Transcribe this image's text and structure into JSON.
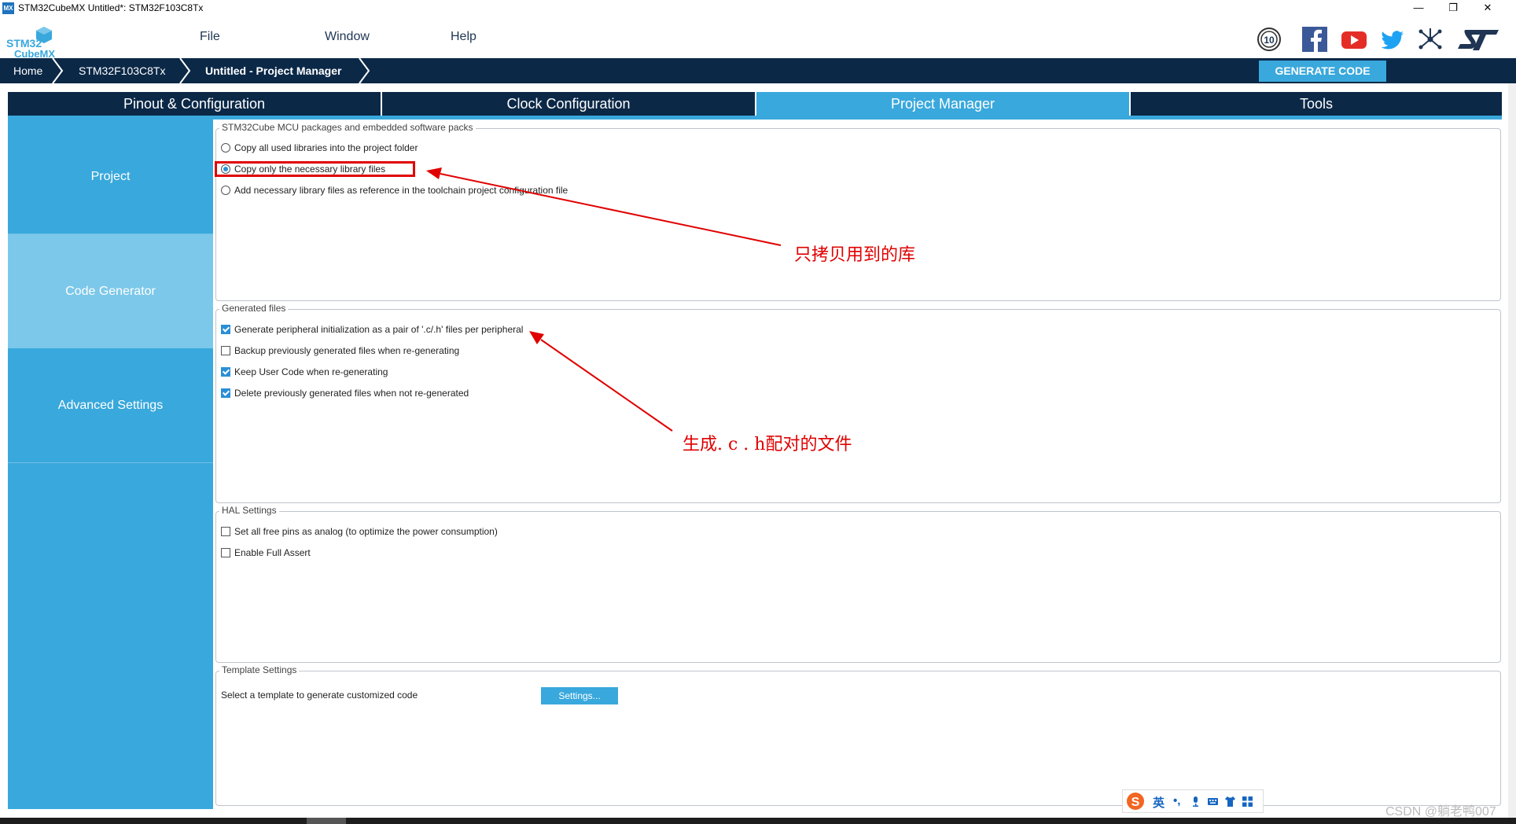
{
  "window": {
    "app_icon": "MX",
    "title": "STM32CubeMX Untitled*: STM32F103C8Tx",
    "controls": [
      "—",
      "❐",
      "✕"
    ]
  },
  "logo": {
    "line1": "STM32",
    "line2": "CubeMX"
  },
  "menu": {
    "items": [
      "File",
      "Window",
      "Help"
    ]
  },
  "social_icons": [
    "anniversary-10-icon",
    "facebook-icon",
    "youtube-icon",
    "twitter-icon",
    "network-icon",
    "st-logo-icon"
  ],
  "badge": {
    "anniversary": "10"
  },
  "breadcrumb": {
    "items": [
      "Home",
      "STM32F103C8Tx",
      "Untitled - Project Manager"
    ]
  },
  "generate_button": "GENERATE CODE",
  "tabs": [
    {
      "label": "Pinout & Configuration",
      "active": false
    },
    {
      "label": "Clock Configuration",
      "active": false
    },
    {
      "label": "Project Manager",
      "active": true
    },
    {
      "label": "Tools",
      "active": false
    }
  ],
  "sidebar": {
    "items": [
      {
        "label": "Project",
        "active": false
      },
      {
        "label": "Code Generator",
        "active": true
      },
      {
        "label": "Advanced Settings",
        "active": false
      }
    ]
  },
  "packages": {
    "legend": "STM32Cube MCU packages and embedded software packs",
    "options": [
      {
        "label": "Copy all used libraries into the project folder",
        "selected": false
      },
      {
        "label": "Copy only the necessary library files",
        "selected": true
      },
      {
        "label": "Add necessary library files as reference in the toolchain project configuration file",
        "selected": false
      }
    ]
  },
  "generated_files": {
    "legend": "Generated files",
    "options": [
      {
        "label": "Generate peripheral initialization as a pair of '.c/.h' files per peripheral",
        "checked": true
      },
      {
        "label": "Backup previously generated files when re-generating",
        "checked": false
      },
      {
        "label": "Keep User Code when re-generating",
        "checked": true
      },
      {
        "label": "Delete previously generated files when not re-generated",
        "checked": true
      }
    ]
  },
  "hal_settings": {
    "legend": "HAL Settings",
    "options": [
      {
        "label": "Set all free pins as analog (to optimize the power consumption)",
        "checked": false
      },
      {
        "label": "Enable Full Assert",
        "checked": false
      }
    ]
  },
  "template_settings": {
    "legend": "Template Settings",
    "description": "Select a template to generate customized code",
    "button": "Settings..."
  },
  "annotations": {
    "note1": "只拷贝用到的库",
    "note2": "生成. c . h配对的文件",
    "color": "#e00000"
  },
  "ime": {
    "label": "英",
    "punct": "•,",
    "logo": "S"
  },
  "watermark": "CSDN @躺老鸭007",
  "colors": {
    "navy": "#0b2847",
    "accent": "#39a8dc",
    "active_sidebar": "#7cc8ea"
  }
}
